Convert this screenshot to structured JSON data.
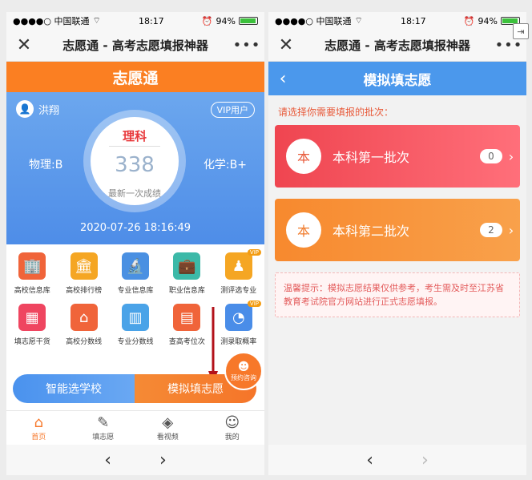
{
  "left": {
    "status": {
      "carrier": "●●●●○ 中国联通",
      "wifi": "⌔",
      "time": "18:17",
      "battery_pct": "94%",
      "battery_level": 0.94
    },
    "titlebar": {
      "close": "✕",
      "title": "志愿通 - 高考志愿填报神器",
      "more": "•••"
    },
    "brand": "志愿通",
    "score_card": {
      "user_name": "洪翔",
      "vip_label": "VIP用户",
      "subject": "理科",
      "score": "338",
      "score_label": "最新一次成绩",
      "left_grade": "物理:B",
      "right_grade": "化学:B+",
      "datetime": "2020-07-26 18:16:49"
    },
    "grid_items": [
      {
        "label": "高校信息库",
        "icon": "school-icon",
        "glyph": "🏢",
        "color": "#f0643a",
        "vip": ""
      },
      {
        "label": "高校排行榜",
        "icon": "ranking-icon",
        "glyph": "🏛",
        "color": "#f5a623",
        "vip": ""
      },
      {
        "label": "专业信息库",
        "icon": "microscope-icon",
        "glyph": "🔬",
        "color": "#4a90e2",
        "vip": ""
      },
      {
        "label": "职业信息库",
        "icon": "briefcase-icon",
        "glyph": "💼",
        "color": "#3cb9a8",
        "vip": ""
      },
      {
        "label": "测评选专业",
        "icon": "assessment-icon",
        "glyph": "♟",
        "color": "#f5a623",
        "vip": "VIP"
      },
      {
        "label": "填志愿干货",
        "icon": "tips-icon",
        "glyph": "▦",
        "color": "#ef4560",
        "vip": ""
      },
      {
        "label": "高校分数线",
        "icon": "school-score-icon",
        "glyph": "⌂",
        "color": "#f0643a",
        "vip": ""
      },
      {
        "label": "专业分数线",
        "icon": "major-score-icon",
        "glyph": "▥",
        "color": "#4aa3e8",
        "vip": ""
      },
      {
        "label": "查高考位次",
        "icon": "rank-query-icon",
        "glyph": "▤",
        "color": "#f0643a",
        "vip": ""
      },
      {
        "label": "测录取概率",
        "icon": "probability-icon",
        "glyph": "◔",
        "color": "#4a8de8",
        "vip": "VIP"
      }
    ],
    "actions": {
      "smart": "智能选学校",
      "simulate": "模拟填志愿"
    },
    "consult": "预约咨询",
    "tabs": [
      {
        "label": "首页",
        "glyph": "⌂",
        "icon": "home-icon"
      },
      {
        "label": "填志愿",
        "glyph": "✎",
        "icon": "form-icon"
      },
      {
        "label": "看视频",
        "glyph": "◈",
        "icon": "video-icon"
      },
      {
        "label": "我的",
        "glyph": "☺",
        "icon": "profile-icon"
      }
    ],
    "nav": {
      "back": "‹",
      "forward": "›"
    }
  },
  "right": {
    "status": {
      "carrier": "●●●●○ 中国联通",
      "wifi": "⌔",
      "time": "18:17",
      "battery_pct": "94%",
      "battery_level": 0.94
    },
    "titlebar": {
      "close": "✕",
      "title": "志愿通 - 高考志愿填报神器",
      "more": "•••"
    },
    "header": {
      "back": "‹",
      "title": "模拟填志愿"
    },
    "prompt": "请选择你需要填报的批次：",
    "batches": [
      {
        "char": "本",
        "name": "本科第一批次",
        "count": "0"
      },
      {
        "char": "本",
        "name": "本科第二批次",
        "count": "2"
      }
    ],
    "tip": "温馨提示：模拟志愿结果仅供参考，考生需及时至江苏省教育考试院官方网站进行正式志愿填报。",
    "nav": {
      "back": "‹",
      "forward": "›"
    }
  }
}
